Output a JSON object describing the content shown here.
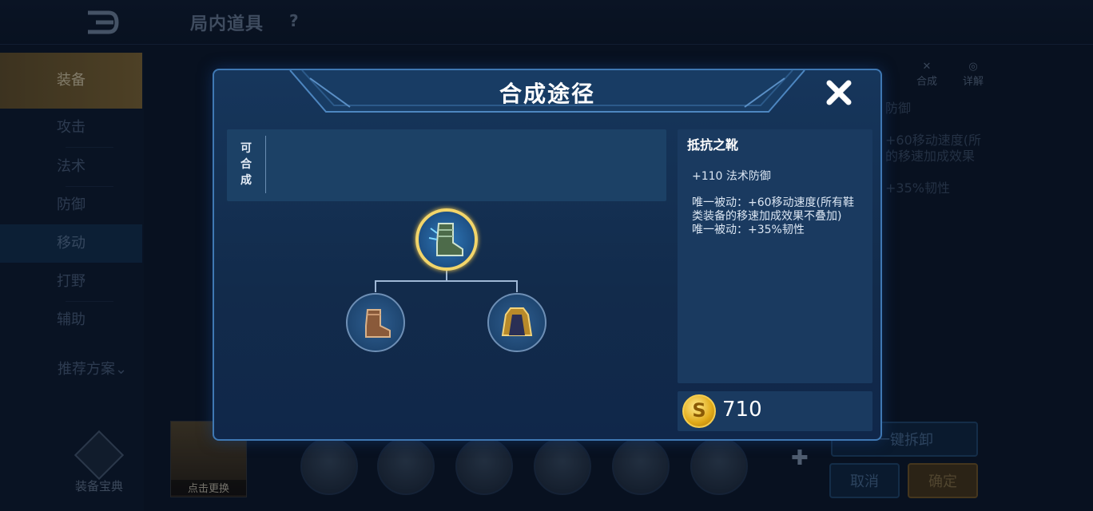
{
  "topbar": {
    "title": "局内道具",
    "help": "?"
  },
  "sidebar": {
    "items": [
      {
        "label": "装备"
      },
      {
        "label": "攻击"
      },
      {
        "label": "法术"
      },
      {
        "label": "防御"
      },
      {
        "label": "移动"
      },
      {
        "label": "打野"
      },
      {
        "label": "辅助"
      }
    ],
    "recommend": "推荐方案",
    "codex": "装备宝典"
  },
  "hero_card": {
    "label": "点击更换"
  },
  "background_panel": {
    "compose": "合成",
    "detail": "详解",
    "lines": [
      "防御",
      "+60移动速度(所",
      "的移速加成效果",
      "+35%韧性"
    ]
  },
  "buttons": {
    "dismantle": "一键拆卸",
    "cancel": "取消",
    "confirm": "确定"
  },
  "modal": {
    "title": "合成途径",
    "craftable_label": "可合成",
    "item": {
      "name": "抵抗之靴",
      "stat": "+110 法术防御",
      "passive": "唯一被动：+60移动速度(所有鞋类装备的移速加成效果不叠加)",
      "passive2": "唯一被动：+35%韧性",
      "price": "710"
    },
    "tree": {
      "root": "resistance-boots-icon",
      "children": [
        "basic-boots-icon",
        "mage-robe-icon"
      ]
    }
  },
  "colors": {
    "modal_border": "#3f78b3",
    "gold": "#f2d56a",
    "panel": "#1a3a60"
  }
}
